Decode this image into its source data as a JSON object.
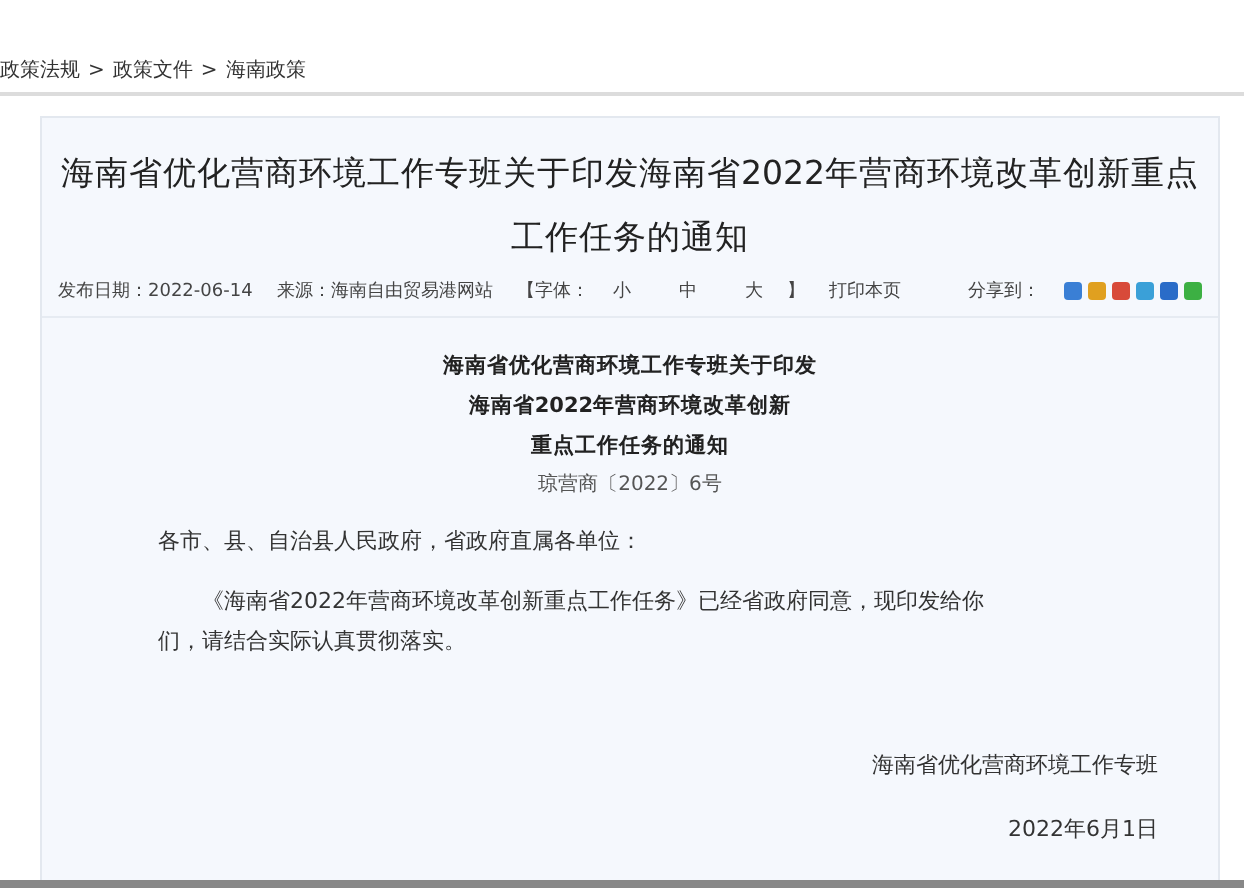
{
  "breadcrumb": [
    "政策法规",
    ">",
    "政策文件",
    ">",
    "海南政策"
  ],
  "article": {
    "title": "海南省优化营商环境工作专班关于印发海南省2022年营商环境改革创新重点工作任务的通知",
    "meta": {
      "date": "发布日期：2022-06-14",
      "source": "来源：海南自由贸易港网站",
      "font_open": "【字体：",
      "font_sizes": [
        "小",
        "中",
        "大"
      ],
      "font_close": "】",
      "print": "打印本页",
      "share": "分享到："
    },
    "share_icons": [
      {
        "color": "#3a7fd5"
      },
      {
        "color": "#e0a020"
      },
      {
        "color": "#d84a3a"
      },
      {
        "color": "#3aa0d8"
      },
      {
        "color": "#2a6cc8"
      },
      {
        "color": "#3cb043"
      }
    ],
    "doc_title": [
      "海南省优化营商环境工作专班关于印发",
      "海南省2022年营商环境改革创新",
      "重点工作任务的通知"
    ],
    "doc_number": "琼营商〔2022〕6号",
    "greeting": "各市、县、自治县人民政府，省政府直属各单位：",
    "body": "《海南省2022年营商环境改革创新重点工作任务》已经省政府同意，现印发给你们，请结合实际认真贯彻落实。",
    "signature": "海南省优化营商环境工作专班",
    "sign_date": "2022年6月1日"
  }
}
